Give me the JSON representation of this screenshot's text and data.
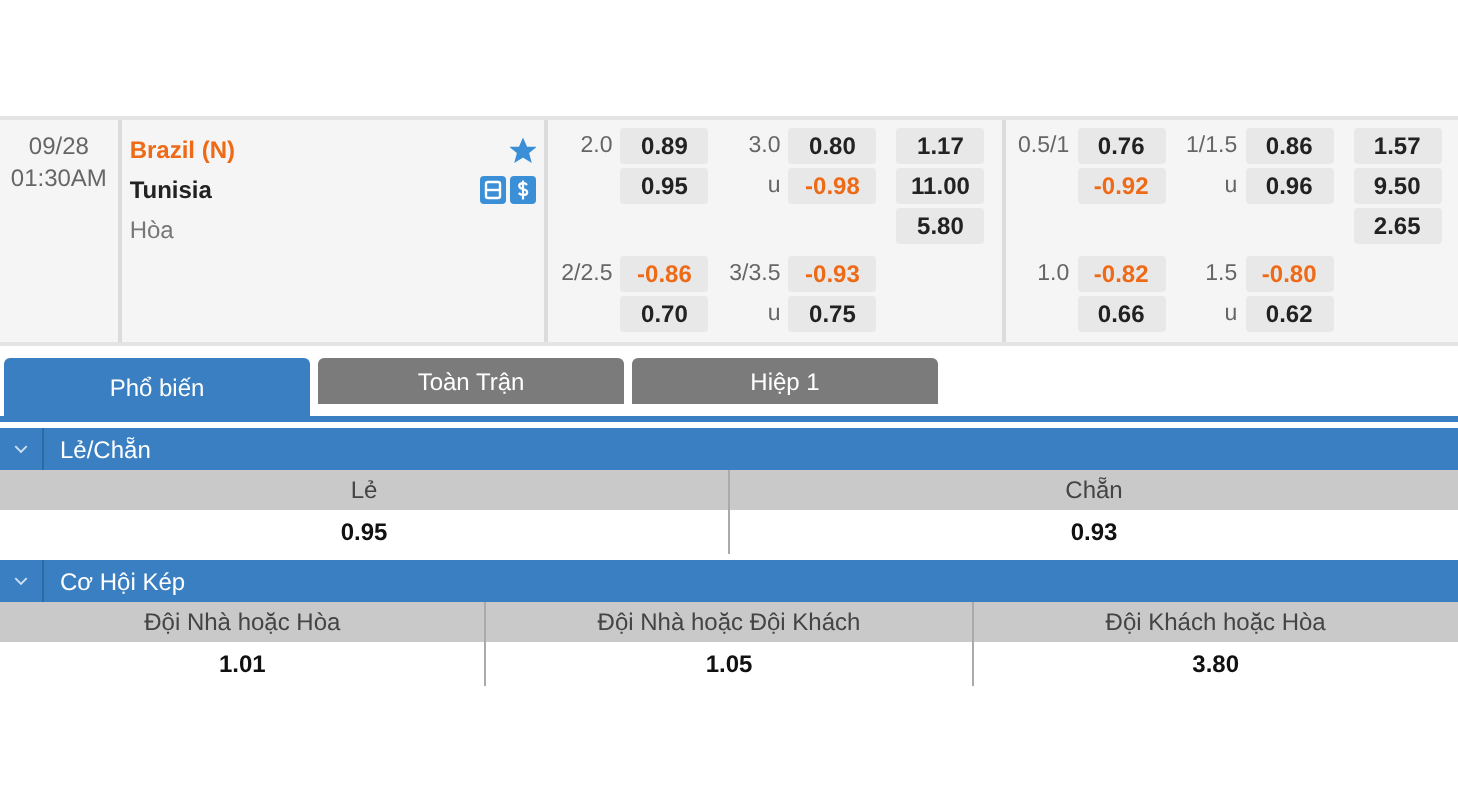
{
  "match": {
    "date": "09/28",
    "time": "01:30AM",
    "home": "Brazil (N)",
    "away": "Tunisia",
    "draw": "Hòa",
    "favorite": true
  },
  "odds_groups": [
    {
      "main": {
        "handicap": [
          {
            "line": "2.0",
            "value": "0.89",
            "negative": false
          },
          {
            "value": "0.95",
            "negative": false
          }
        ],
        "over_under": [
          {
            "line": "3.0",
            "value": "0.80",
            "negative": false
          },
          {
            "line": "u",
            "value": "-0.98",
            "negative": true
          }
        ],
        "one_x_two": [
          "1.17",
          "11.00",
          "5.80"
        ]
      },
      "alt": {
        "handicap": [
          {
            "line": "2/2.5",
            "value": "-0.86",
            "negative": true
          },
          {
            "value": "0.70",
            "negative": false
          }
        ],
        "over_under": [
          {
            "line": "3/3.5",
            "value": "-0.93",
            "negative": true
          },
          {
            "line": "u",
            "value": "0.75",
            "negative": false
          }
        ]
      }
    },
    {
      "main": {
        "handicap": [
          {
            "line": "0.5/1",
            "value": "0.76",
            "negative": false
          },
          {
            "value": "-0.92",
            "negative": true
          }
        ],
        "over_under": [
          {
            "line": "1/1.5",
            "value": "0.86",
            "negative": false
          },
          {
            "line": "u",
            "value": "0.96",
            "negative": false
          }
        ],
        "one_x_two": [
          "1.57",
          "9.50",
          "2.65"
        ]
      },
      "alt": {
        "handicap": [
          {
            "line": "1.0",
            "value": "-0.82",
            "negative": true
          },
          {
            "value": "0.66",
            "negative": false
          }
        ],
        "over_under": [
          {
            "line": "1.5",
            "value": "-0.80",
            "negative": true
          },
          {
            "line": "u",
            "value": "0.62",
            "negative": false
          }
        ]
      }
    }
  ],
  "tabs": [
    {
      "label": "Phổ biến",
      "selected": true
    },
    {
      "label": "Toàn Trận",
      "selected": false
    },
    {
      "label": "Hiệp 1",
      "selected": false
    }
  ],
  "sections": [
    {
      "title": "Lẻ/Chẵn",
      "expanded": true,
      "columns": [
        "Lẻ",
        "Chẵn"
      ],
      "values": [
        "0.95",
        "0.93"
      ]
    },
    {
      "title": "Cơ Hội Kép",
      "expanded": true,
      "columns": [
        "Đội Nhà hoặc Hòa",
        "Đội Nhà hoặc Đội Khách",
        "Đội Khách hoặc Hòa"
      ],
      "values": [
        "1.01",
        "1.05",
        "3.80"
      ]
    }
  ]
}
